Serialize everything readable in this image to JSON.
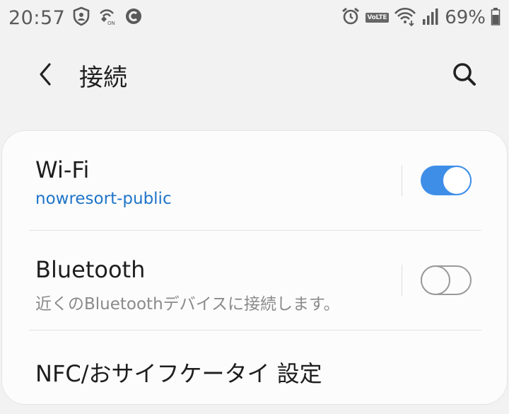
{
  "status_bar": {
    "time": "20:57",
    "battery_percent": "69%",
    "volte_label": "VoLTE",
    "icons_left": [
      "shield-icon",
      "wifi-calling-icon",
      "c-circle-icon"
    ],
    "icons_right": [
      "alarm-icon",
      "volte-icon",
      "wifi-icon",
      "signal-icon",
      "battery-icon"
    ]
  },
  "header": {
    "title": "接続"
  },
  "settings": {
    "wifi": {
      "title": "Wi-Fi",
      "subtitle": "nowresort-public",
      "enabled": true
    },
    "bluetooth": {
      "title": "Bluetooth",
      "subtitle": "近くのBluetoothデバイスに接続します。",
      "enabled": false
    },
    "nfc": {
      "title": "NFC/おサイフケータイ 設定"
    }
  },
  "colors": {
    "accent": "#3e8ee8",
    "subtitle_accent": "#1f74c9",
    "background": "#f2f2f2",
    "card": "#fcfcfc"
  }
}
